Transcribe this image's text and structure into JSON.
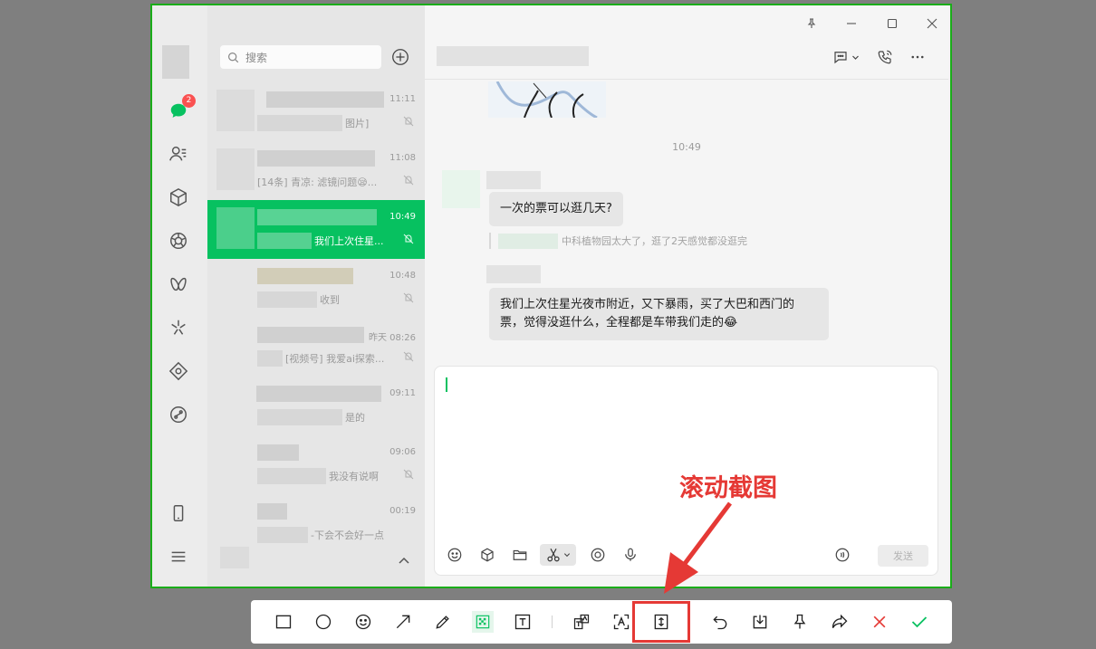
{
  "app": {
    "nav_badge": "2",
    "search_placeholder": "搜索",
    "conversations": [
      {
        "time": "11:11",
        "preview": "图片]",
        "active": false
      },
      {
        "time": "11:08",
        "preview": "[14条] 青凉: 滤镜问题😪...",
        "active": false
      },
      {
        "time": "10:49",
        "preview": "我们上次住星...",
        "active": true
      },
      {
        "time": "10:48",
        "preview": "收到",
        "active": false
      },
      {
        "time": "昨天 08:26",
        "preview": "[视频号] 我爱ai探索...",
        "active": false
      },
      {
        "time": "09:11",
        "preview": "是的",
        "active": false
      },
      {
        "time": "09:06",
        "preview": "我没有说啊",
        "active": false
      },
      {
        "time": "00:19",
        "preview": "-下会不会好一点",
        "active": false
      }
    ],
    "chat": {
      "timestamp": "10:49",
      "message1": "一次的票可以逛几天?",
      "quote": "中科植物园太大了，逛了2天感觉都没逛完",
      "message2_line1": "我们上次住星光夜市附近，又下暴雨，买了大巴和西门的",
      "message2_line2": "票，觉得没逛什么，全程都是车带我们走的😂",
      "send_label": "发送"
    }
  },
  "annotation": {
    "label": "滚动截图",
    "color": "#e53935"
  },
  "toolbar": {
    "tools": [
      "rectangle-icon",
      "ellipse-icon",
      "emoji-icon",
      "arrow-icon",
      "pen-icon",
      "mosaic-icon",
      "text-icon",
      "translate-icon",
      "ocr-icon",
      "scroll-capture-icon",
      "undo-icon",
      "download-icon",
      "pin-icon",
      "share-icon",
      "cancel-icon",
      "confirm-icon"
    ],
    "highlighted_tool": "scroll-capture-icon"
  },
  "colors": {
    "accent": "#07c160",
    "frame": "#1aad19",
    "badge": "#fa5151",
    "annotation": "#e53935"
  }
}
